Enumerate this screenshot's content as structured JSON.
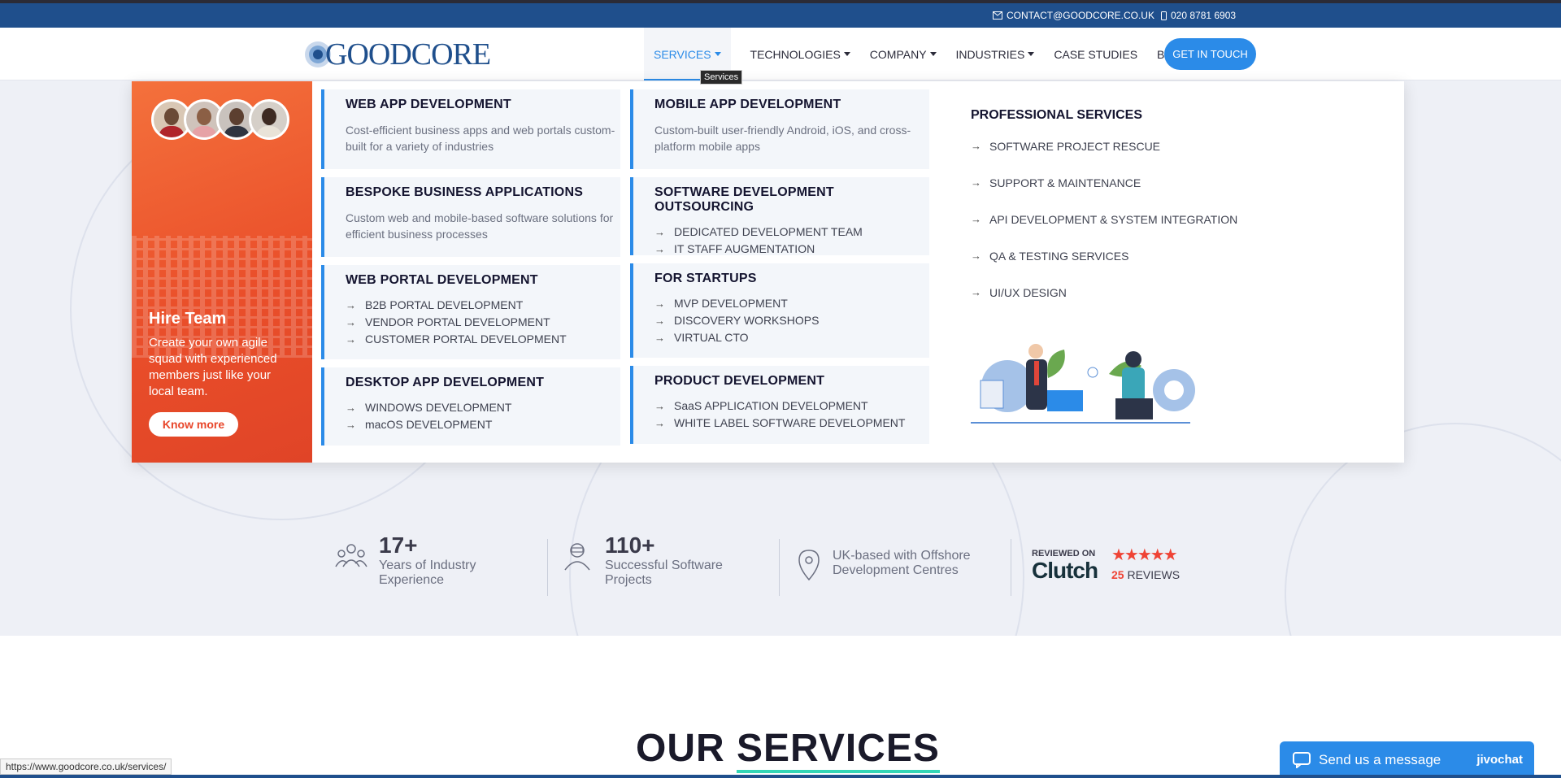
{
  "topbar": {
    "email": "CONTACT@GOODCORE.CO.UK",
    "phone": "020 8781 6903"
  },
  "logo": {
    "text": "GOODCORE"
  },
  "nav": {
    "items": [
      {
        "label": "SERVICES",
        "dropdown": true,
        "active": true
      },
      {
        "label": "TECHNOLOGIES",
        "dropdown": true
      },
      {
        "label": "COMPANY",
        "dropdown": true
      },
      {
        "label": "INDUSTRIES",
        "dropdown": true
      },
      {
        "label": "CASE STUDIES"
      },
      {
        "label": "BLOG"
      }
    ],
    "cta": "GET IN TOUCH",
    "tooltip": "Services"
  },
  "mega": {
    "promo": {
      "title": "Hire Team",
      "text": "Create your own agile squad with experienced members just like your local team.",
      "button": "Know more"
    },
    "cards": [
      {
        "title": "WEB APP DEVELOPMENT",
        "desc": "Cost-efficient business apps and web portals custom-built for a variety of industries"
      },
      {
        "title": "MOBILE APP DEVELOPMENT",
        "desc": "Custom-built user-friendly Android, iOS, and cross-platform mobile apps"
      },
      {
        "title": "BESPOKE BUSINESS APPLICATIONS",
        "desc": "Custom web and mobile-based software solutions for efficient business processes"
      },
      {
        "title": "SOFTWARE DEVELOPMENT OUTSOURCING",
        "items": [
          "DEDICATED DEVELOPMENT TEAM",
          "IT STAFF AUGMENTATION"
        ]
      },
      {
        "title": "WEB PORTAL DEVELOPMENT",
        "items": [
          "B2B PORTAL DEVELOPMENT",
          "VENDOR PORTAL DEVELOPMENT",
          "CUSTOMER PORTAL DEVELOPMENT"
        ]
      },
      {
        "title": "FOR STARTUPS",
        "items": [
          "MVP DEVELOPMENT",
          "DISCOVERY WORKSHOPS",
          "VIRTUAL CTO"
        ]
      },
      {
        "title": "DESKTOP APP DEVELOPMENT",
        "items": [
          "WINDOWS DEVELOPMENT",
          "macOS DEVELOPMENT"
        ]
      },
      {
        "title": "PRODUCT DEVELOPMENT",
        "items": [
          "SaaS APPLICATION DEVELOPMENT",
          "WHITE LABEL SOFTWARE DEVELOPMENT"
        ]
      }
    ],
    "professional": {
      "title": "PROFESSIONAL SERVICES",
      "items": [
        "SOFTWARE PROJECT RESCUE",
        "SUPPORT & MAINTENANCE",
        "API DEVELOPMENT & SYSTEM INTEGRATION",
        "QA & TESTING SERVICES",
        "UI/UX DESIGN"
      ]
    }
  },
  "stats": [
    {
      "num": "17+",
      "label1": "Years of Industry",
      "label2": "Experience",
      "icon": "team-icon"
    },
    {
      "num": "110+",
      "label1": "Successful Software",
      "label2": "Projects",
      "icon": "developer-icon"
    },
    {
      "num": "",
      "label1": "UK-based with Offshore",
      "label2": "Development Centres",
      "icon": "location-pin-icon"
    }
  ],
  "clutch": {
    "reviewed": "REVIEWED ON",
    "brand": "Clutch",
    "count": "25",
    "reviews": "REVIEWS",
    "stars": 5
  },
  "section": {
    "title_a": "OUR ",
    "title_b": "SERVICES"
  },
  "statusbar": {
    "url": "https://www.goodcore.co.uk/services/"
  },
  "chat": {
    "label": "Send us a message",
    "brand": "jivochat"
  },
  "colors": {
    "primary": "#2b8be8",
    "navy": "#1f4f8c",
    "orange": "#ea4f2a",
    "accent": "#33d6b6"
  }
}
